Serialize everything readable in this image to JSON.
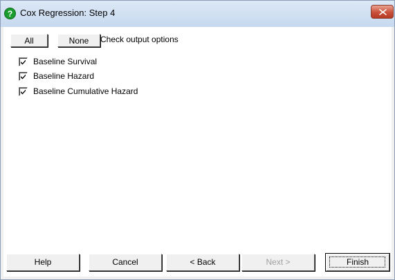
{
  "window": {
    "title": "Cox Regression: Step 4",
    "title_icon": "question-circle-icon",
    "close_icon": "close-icon"
  },
  "toolbar": {
    "all_label": "All",
    "none_label": "None",
    "check_text": "Check output options"
  },
  "options": [
    {
      "label": "Baseline Survival",
      "checked": true
    },
    {
      "label": "Baseline Hazard",
      "checked": true
    },
    {
      "label": "Baseline Cumulative Hazard",
      "checked": true
    }
  ],
  "footer": {
    "help_label": "Help",
    "cancel_label": "Cancel",
    "back_label": "< Back",
    "next_label": "Next >",
    "finish_label": "Finish"
  },
  "colors": {
    "icon_green": "#1a9c2e",
    "close_red": "#c9503a",
    "titlebar": "#c7d9ef"
  }
}
